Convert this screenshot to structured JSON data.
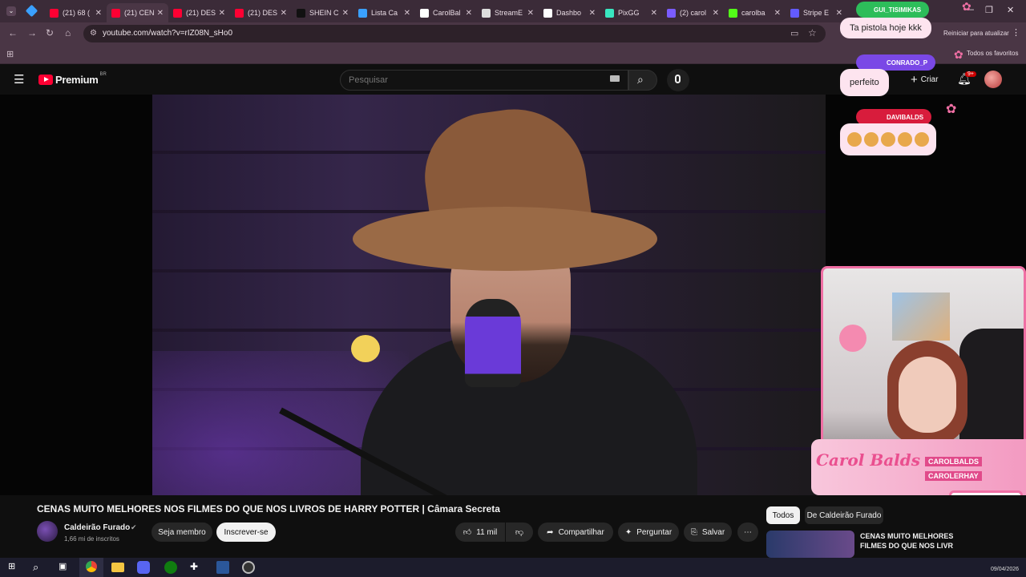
{
  "browser": {
    "tabs": [
      {
        "label": "(21) 68 (",
        "color": "#ff0033"
      },
      {
        "label": "(21) CEN",
        "color": "#ff0033",
        "active": true
      },
      {
        "label": "(21) DES",
        "color": "#ff0033"
      },
      {
        "label": "(21) DES",
        "color": "#ff0033"
      },
      {
        "label": "SHEIN C",
        "color": "#111111"
      },
      {
        "label": "Lista Ca",
        "color": "#3aa0ff"
      },
      {
        "label": "CarolBal",
        "color": "#ffffff"
      },
      {
        "label": "StreamE",
        "color": "#dddddd"
      },
      {
        "label": "Dashbo",
        "color": "#ffffff"
      },
      {
        "label": "PixGG",
        "color": "#39e6c0"
      },
      {
        "label": "(2) carol",
        "color": "#7a5cff"
      },
      {
        "label": "carolba",
        "color": "#53fc18"
      },
      {
        "label": "Stripe E",
        "color": "#635bff"
      }
    ],
    "url": "youtube.com/watch?v=rIZ08N_sHo0",
    "restart_label": "Reiniciar para atualizar",
    "all_favorites_label": "Todos os favoritos"
  },
  "youtube": {
    "logo_text": "Premium",
    "region": "BR",
    "search_placeholder": "Pesquisar",
    "create_label": "Criar",
    "notif_badge": "9+",
    "video": {
      "title": "CENAS MUITO MELHORES NOS FILMES DO QUE NOS LIVROS DE HARRY POTTER | Câmara Secreta",
      "channel": "Caldeirão Furado",
      "subscribers": "1,66 mi de inscritos",
      "member_label": "Seja membro",
      "subscribe_label": "Inscrever-se",
      "likes": "11 mil",
      "share_label": "Compartilhar",
      "ask_label": "Perguntar",
      "save_label": "Salvar"
    },
    "sidebar": {
      "chips": [
        "Todos",
        "De Caldeirão Furado"
      ],
      "next_title_line1": "CENAS MUITO MELHORES",
      "next_title_line2": "FILMES DO QUE NOS LIVR"
    }
  },
  "stream_overlay": {
    "chat": [
      {
        "user": "GUI_TISIMIKAS",
        "message": "Ta pistola hoje kkk"
      },
      {
        "user": "CONRADO_P",
        "message": "perfeito"
      },
      {
        "user": "DAVIBALDS",
        "message": ""
      }
    ],
    "brand": "Carol Balds",
    "socials": [
      "CAROLBALDS",
      "CAROLERHAY"
    ]
  },
  "taskbar": {
    "date": "09/04/2026"
  }
}
